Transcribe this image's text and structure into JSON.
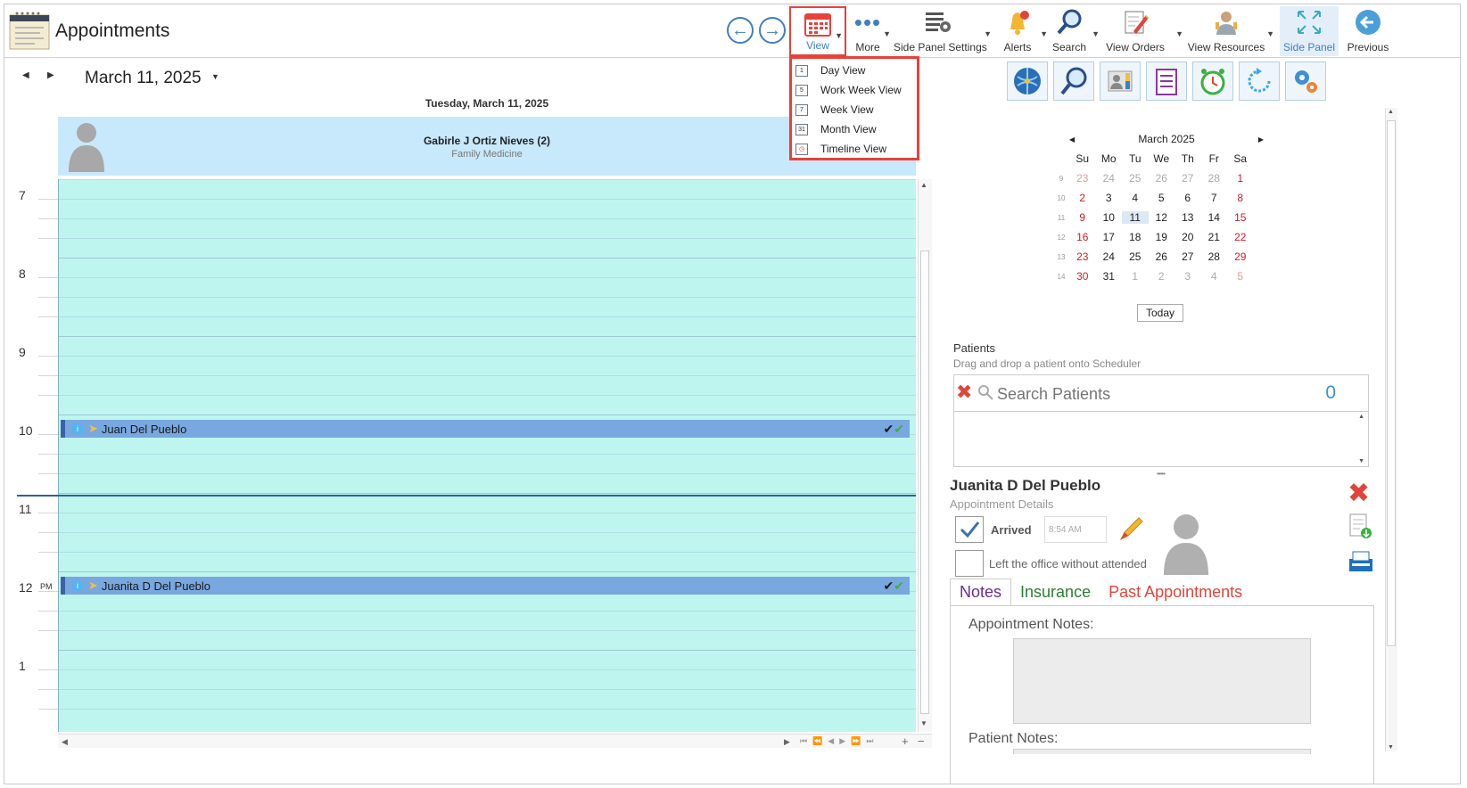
{
  "app": {
    "title": "Appointments"
  },
  "toolbar": {
    "view": "View",
    "more": "More",
    "side_panel_settings": "Side Panel Settings",
    "alerts": "Alerts",
    "search": "Search",
    "view_orders": "View Orders",
    "view_resources": "View Resources",
    "side_panel": "Side Panel",
    "previous": "Previous"
  },
  "view_menu": {
    "items": [
      {
        "label": "Day View",
        "icon_text": "1"
      },
      {
        "label": "Work Week View",
        "icon_text": "5"
      },
      {
        "label": "Week View",
        "icon_text": "7"
      },
      {
        "label": "Month View",
        "icon_text": "31"
      },
      {
        "label": "Timeline View",
        "icon_text": ""
      }
    ]
  },
  "scheduler": {
    "date": "March 11, 2025",
    "day_header": "Tuesday, March 11, 2025",
    "resource_name": "Gabirle J Ortiz Nieves (2)",
    "resource_specialty": "Family Medicine",
    "hours": [
      "7",
      "8",
      "9",
      "10",
      "11",
      "12",
      "1"
    ],
    "pm_label": "PM",
    "appointments": [
      {
        "name": "Juan Del Pueblo"
      },
      {
        "name": "Juanita D Del Pueblo"
      }
    ]
  },
  "mini_calendar": {
    "month": "March 2025",
    "weekdays": [
      "Su",
      "Mo",
      "Tu",
      "We",
      "Th",
      "Fr",
      "Sa"
    ],
    "weeks": [
      {
        "wk": "9",
        "days": [
          "23",
          "24",
          "25",
          "26",
          "27",
          "28",
          "1"
        ]
      },
      {
        "wk": "10",
        "days": [
          "2",
          "3",
          "4",
          "5",
          "6",
          "7",
          "8"
        ]
      },
      {
        "wk": "11",
        "days": [
          "9",
          "10",
          "11",
          "12",
          "13",
          "14",
          "15"
        ]
      },
      {
        "wk": "12",
        "days": [
          "16",
          "17",
          "18",
          "19",
          "20",
          "21",
          "22"
        ]
      },
      {
        "wk": "13",
        "days": [
          "23",
          "24",
          "25",
          "26",
          "27",
          "28",
          "29"
        ]
      },
      {
        "wk": "14",
        "days": [
          "30",
          "31",
          "1",
          "2",
          "3",
          "4",
          "5"
        ]
      }
    ],
    "today_label": "Today"
  },
  "patients": {
    "title": "Patients",
    "hint": "Drag and drop a patient onto Scheduler",
    "search_placeholder": "Search Patients",
    "count": "0"
  },
  "appointment_details": {
    "patient_name": "Juanita D Del Pueblo",
    "subtitle": "Appointment Details",
    "arrived_label": "Arrived",
    "arrived_time": "8:54 AM",
    "left_label": "Left the office without attended",
    "tabs": [
      "Notes",
      "Insurance",
      "Past Appointments"
    ],
    "appointment_notes_label": "Appointment Notes:",
    "patient_notes_label": "Patient Notes:"
  },
  "colors": {
    "accent": "#3d7fc4",
    "highlight_border": "#e8413a",
    "grid_bg": "#bff5ef",
    "appointment_bar": "#79a7e0",
    "resource_header": "#c8e8fb"
  }
}
